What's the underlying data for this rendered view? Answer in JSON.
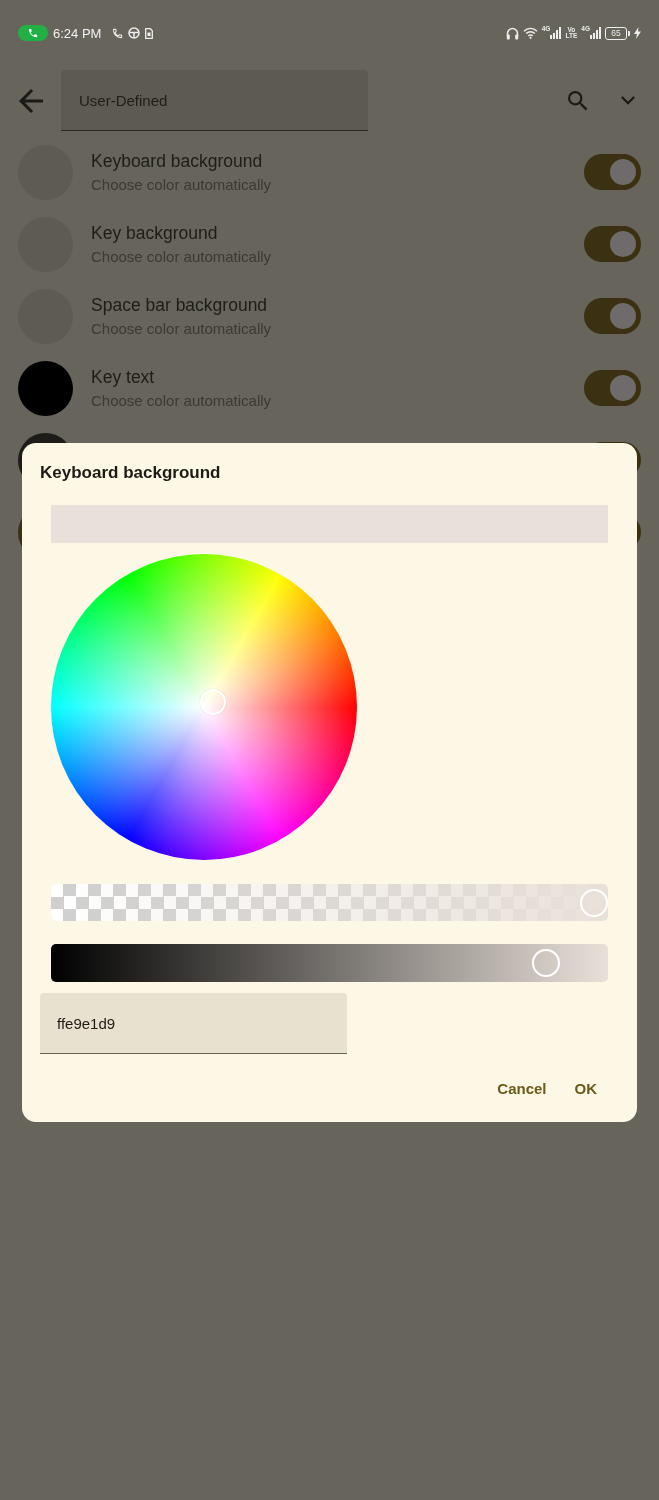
{
  "status_bar": {
    "time": "6:24 PM",
    "sim1_network": "4G",
    "volte": "Vo LTE",
    "sim2_network": "4G",
    "battery": "65"
  },
  "header": {
    "selector": {
      "value": "User-Defined"
    }
  },
  "rows": [
    {
      "title": "Keyboard background",
      "subtitle": "Choose color automatically",
      "color": "#5e5b54",
      "on": true
    },
    {
      "title": "Key background",
      "subtitle": "Choose color automatically",
      "color": "#5e5b54",
      "on": true
    },
    {
      "title": "Space bar background",
      "subtitle": "Choose color automatically",
      "color": "#5e5b54",
      "on": true
    },
    {
      "title": "Key text",
      "subtitle": "Choose color automatically",
      "color": "#000000",
      "on": true
    },
    {
      "color": "#1d1c1a",
      "on": true
    },
    {
      "color": "#3a3017",
      "on": true
    }
  ],
  "dialog": {
    "title": "Keyboard background",
    "alpha_slider": {
      "level": 1
    },
    "brightness_slider": {
      "level": 0.91
    },
    "hex_field": {
      "value": "ffe9e1d9"
    },
    "buttons": [
      "Cancel",
      "OK"
    ]
  }
}
